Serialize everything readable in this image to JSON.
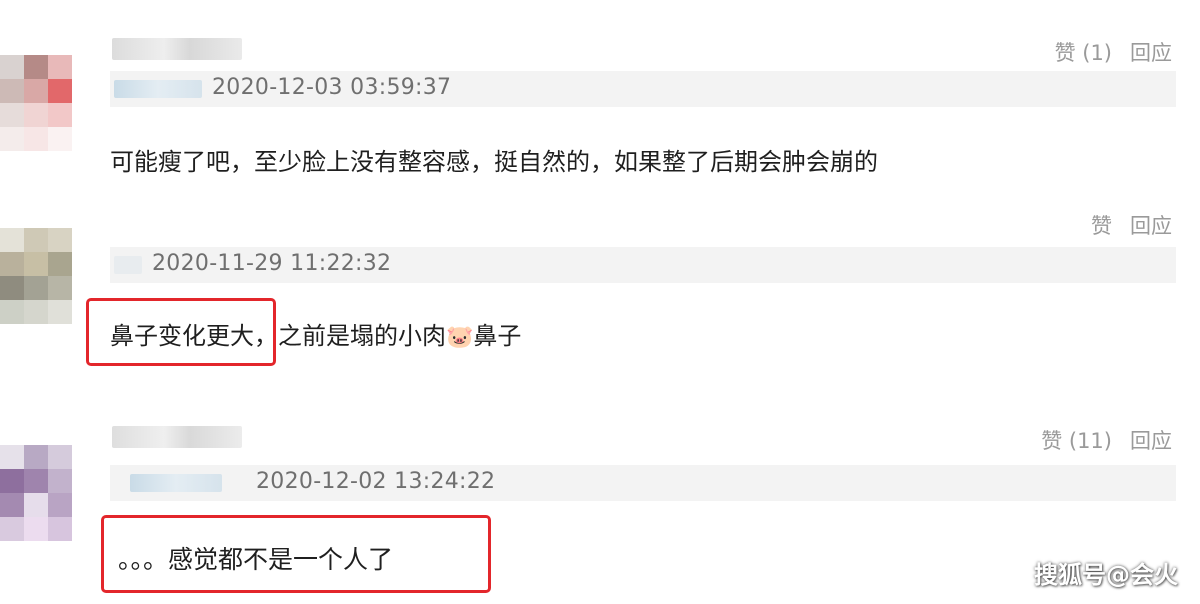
{
  "comments": [
    {
      "timestamp": "2020-12-03 03:59:37",
      "like_label": "赞 (1)",
      "reply_label": "回应",
      "text": "可能瘦了吧，至少脸上没有整容感，挺自然的，如果整了后期会肿会崩的"
    },
    {
      "timestamp": "2020-11-29 11:22:32",
      "like_label": "赞",
      "reply_label": "回应",
      "text_highlighted": "鼻子变化更大，",
      "text_rest_before_emoji": "之前是塌的小肉",
      "emoji": "🐷",
      "emoji_name": "pig-face-icon",
      "text_rest_after_emoji": "鼻子"
    },
    {
      "timestamp": "2020-12-02 13:24:22",
      "like_label": "赞 (11)",
      "reply_label": "回应",
      "text": "。。。感觉都不是一个人了"
    }
  ],
  "watermark": "搜狐号@会火",
  "colors": {
    "highlight_border": "#e3262b",
    "meta_bar": "#f3f3f3",
    "action_text": "#9a9a9a"
  }
}
